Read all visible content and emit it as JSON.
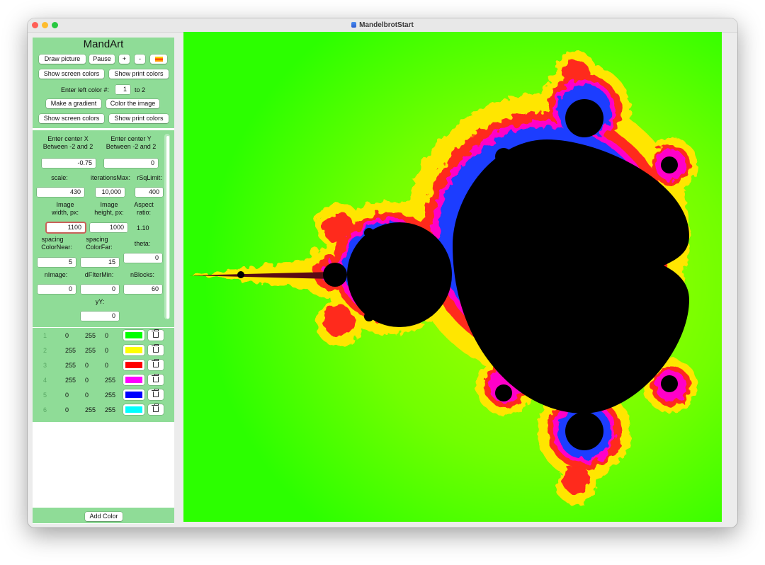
{
  "window": {
    "title": "MandelbrotStart"
  },
  "sidebar": {
    "app_name": "MandArt",
    "buttons": {
      "draw_picture": "Draw picture",
      "pause": "Pause",
      "zoom_in": "+",
      "zoom_out": "-",
      "show_screen_colors_1": "Show screen colors",
      "show_print_colors_1": "Show print colors",
      "make_gradient": "Make a gradient",
      "color_image": "Color the image",
      "show_screen_colors_2": "Show screen colors",
      "show_print_colors_2": "Show print colors",
      "add_color": "Add Color"
    },
    "gradient": {
      "left_label": "Enter left color #:",
      "left_value": "1",
      "to_label": "to 2"
    },
    "params": {
      "center_x_label_1": "Enter center X",
      "center_x_label_2": "Between -2 and 2",
      "center_y_label_1": "Enter center Y",
      "center_y_label_2": "Between -2 and 2",
      "center_x": "-0.75",
      "center_y": "0",
      "scale_label": "scale:",
      "iterations_label": "iterationsMax:",
      "rsq_label": "rSqLimit:",
      "scale": "430",
      "iterations": "10,000",
      "rsq": "400",
      "width_label_1": "Image",
      "width_label_2": "width, px:",
      "height_label_1": "Image",
      "height_label_2": "height, px:",
      "aspect_label_1": "Aspect",
      "aspect_label_2": "ratio:",
      "width": "1100",
      "height": "1000",
      "aspect": "1.10",
      "near_label_1": "spacing",
      "near_label_2": "ColorNear:",
      "far_label_1": "spacing",
      "far_label_2": "ColorFar:",
      "theta_label": "theta:",
      "theta": "0",
      "near": "5",
      "far": "15",
      "nimage_label": "nImage:",
      "dfilter_label": "dFIterMin:",
      "nblocks_label": "nBlocks:",
      "nimage": "0",
      "dfilter": "0",
      "nblocks": "60",
      "yy_label": "yY:",
      "yy": "0"
    },
    "colors": [
      {
        "num": "1",
        "r": "0",
        "g": "255",
        "b": "0",
        "hex": "#00ff00"
      },
      {
        "num": "2",
        "r": "255",
        "g": "255",
        "b": "0",
        "hex": "#ffff00"
      },
      {
        "num": "3",
        "r": "255",
        "g": "0",
        "b": "0",
        "hex": "#ff0000"
      },
      {
        "num": "4",
        "r": "255",
        "g": "0",
        "b": "255",
        "hex": "#ff00ff"
      },
      {
        "num": "5",
        "r": "0",
        "g": "0",
        "b": "255",
        "hex": "#0000ff"
      },
      {
        "num": "6",
        "r": "0",
        "g": "255",
        "b": "255",
        "hex": "#00ffff"
      }
    ]
  },
  "icons": {
    "swatch": "color-palette-icon",
    "delete": "trash-icon"
  },
  "canvas": {
    "fractal": "mandelbrot",
    "set_color": "#000000",
    "background_color": "#44ff00"
  }
}
